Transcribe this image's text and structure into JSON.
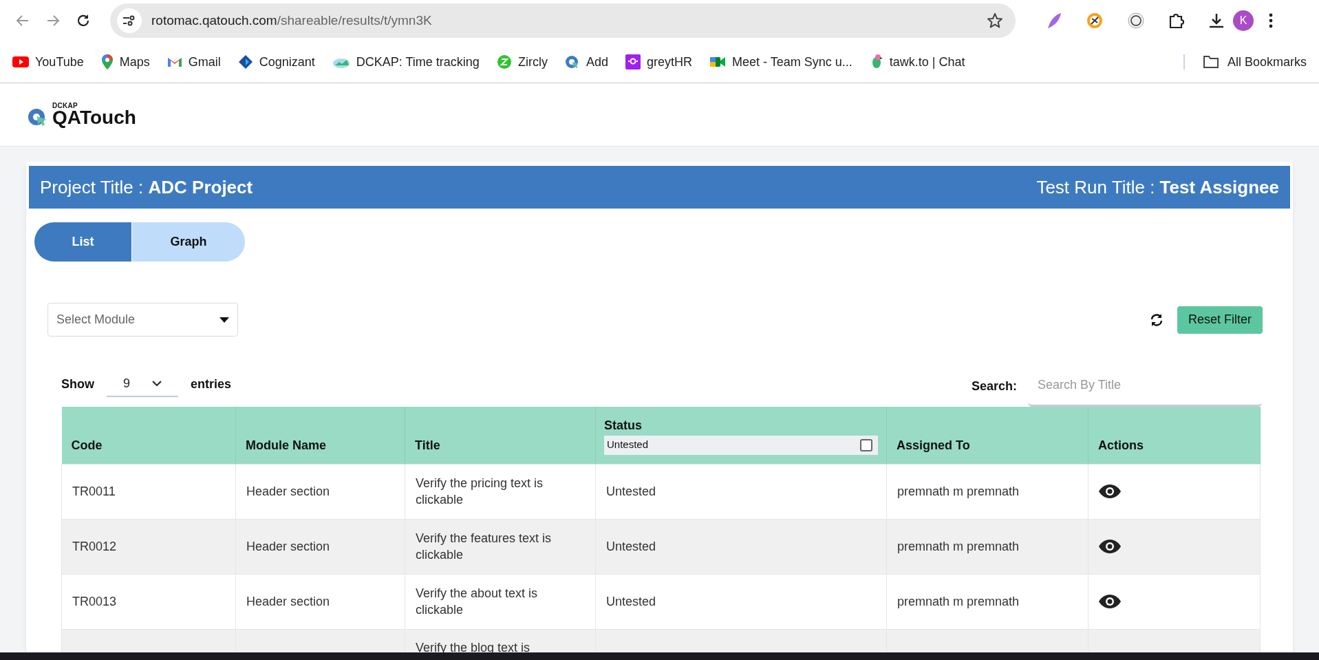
{
  "browser": {
    "url_host": "rotomac.qatouch.com",
    "url_path": "/shareable/results/t/ymn3K",
    "profile_initial": "K",
    "bookmarks": [
      {
        "label": "YouTube",
        "kind": "youtube"
      },
      {
        "label": "Maps",
        "kind": "maps"
      },
      {
        "label": "Gmail",
        "kind": "gmail"
      },
      {
        "label": "Cognizant",
        "kind": "cognizant"
      },
      {
        "label": "DCKAP: Time tracking",
        "kind": "cloud"
      },
      {
        "label": "Zircly",
        "kind": "zircly"
      },
      {
        "label": "Add",
        "kind": "qatouch"
      },
      {
        "label": "greytHR",
        "kind": "greyt"
      },
      {
        "label": "Meet - Team Sync u...",
        "kind": "meet"
      },
      {
        "label": "tawk.to | Chat",
        "kind": "parrot"
      }
    ],
    "all_bookmarks": "All Bookmarks"
  },
  "logo": {
    "brand": "DCKAP",
    "product": "QATouch"
  },
  "header": {
    "project_label": "Project Title : ",
    "project": "ADC Project",
    "run_label": "Test Run Title : ",
    "run": "Test Assignee"
  },
  "view_tabs": [
    {
      "label": "List",
      "selected": true
    },
    {
      "label": "Graph",
      "selected": false
    }
  ],
  "module_select": {
    "placeholder": "Select Module"
  },
  "reset_button": "Reset Filter",
  "show": {
    "label": "Show",
    "value": "9",
    "suffix": "entries"
  },
  "search": {
    "label": "Search:",
    "placeholder": "Search By Title"
  },
  "table": {
    "columns": [
      "Code",
      "Module Name",
      "Title",
      "Status",
      "Assigned To",
      "Actions"
    ],
    "status_filter": {
      "value": "Untested",
      "checked": false
    },
    "rows": [
      {
        "code": "TR0011",
        "module": "Header section",
        "title": "Verify the pricing text is clickable",
        "status": "Untested",
        "assigned": "premnath m premnath"
      },
      {
        "code": "TR0012",
        "module": "Header section",
        "title": "Verify the features text is clickable",
        "status": "Untested",
        "assigned": "premnath m premnath"
      },
      {
        "code": "TR0013",
        "module": "Header section",
        "title": "Verify the about text is clickable",
        "status": "Untested",
        "assigned": "premnath m premnath"
      },
      {
        "title": "Verify the blog text is"
      }
    ]
  }
}
